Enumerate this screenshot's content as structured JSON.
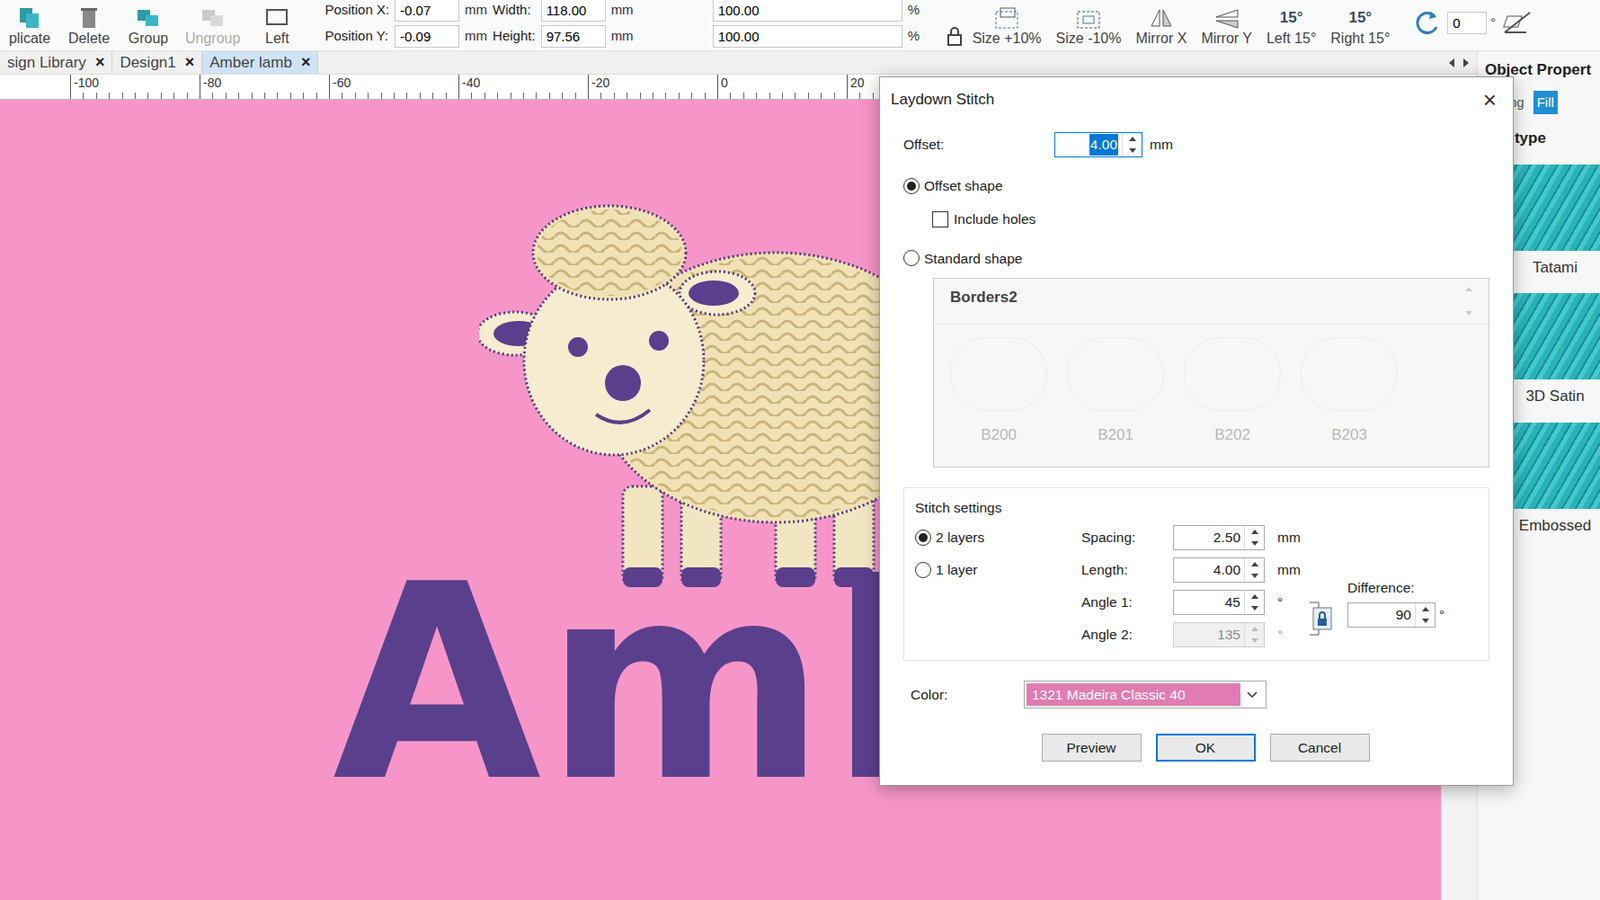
{
  "toolbar": {
    "buttons": [
      {
        "label": "plicate",
        "disabled": false
      },
      {
        "label": "Delete",
        "disabled": false
      },
      {
        "label": "Group",
        "disabled": false
      },
      {
        "label": "Ungroup",
        "disabled": true
      },
      {
        "label": "Left",
        "disabled": false
      }
    ],
    "fields": [
      [
        {
          "label": "Position X:",
          "value": "-0.07",
          "unit": "mm"
        },
        {
          "label": "Width:",
          "value": "118.00",
          "unit": "mm"
        },
        {
          "label": "",
          "value": "100.00",
          "unit": "%"
        }
      ],
      [
        {
          "label": "Position Y:",
          "value": "-0.09",
          "unit": "mm"
        },
        {
          "label": "Height:",
          "value": "97.56",
          "unit": "mm"
        },
        {
          "label": "",
          "value": "100.00",
          "unit": "%"
        }
      ]
    ],
    "transforms": [
      {
        "label": "Size +10%",
        "kind": "grow"
      },
      {
        "label": "Size -10%",
        "kind": "shrink"
      },
      {
        "label": "Mirror X",
        "kind": "mirrorx"
      },
      {
        "label": "Mirror Y",
        "kind": "mirrory"
      },
      {
        "label": "Left 15°",
        "kind": "rotate",
        "badge": "15°"
      },
      {
        "label": "Right 15°",
        "kind": "rotate",
        "badge": "15°"
      }
    ],
    "rotation": {
      "value": "0",
      "unit": "°"
    }
  },
  "doc_tabs": [
    {
      "label": "sign Library",
      "close": "×",
      "selected": false
    },
    {
      "label": "Design1",
      "close": "×",
      "selected": false
    },
    {
      "label": "Amber lamb",
      "close": "×",
      "selected": true
    }
  ],
  "ruler": [
    "-100",
    "-80",
    "-60",
    "-40",
    "-20",
    "0",
    "20"
  ],
  "canvas": {
    "lettering": "Ambe"
  },
  "properties": {
    "title": "Object Propert",
    "tabs": [
      {
        "label": "ttering",
        "selected": false
      },
      {
        "label": "Fill",
        "selected": true
      }
    ],
    "section": "itch type",
    "stitch_types": [
      "Tatami",
      "3D Satin",
      "Embossed"
    ]
  },
  "dialog": {
    "title": "Laydown Stitch",
    "close": "×",
    "offset": {
      "label": "Offset:",
      "value": "4.00",
      "unit": "mm",
      "text_selected": true
    },
    "shape_options": [
      {
        "label": "Offset shape",
        "selected": true
      },
      {
        "label": "Standard shape",
        "selected": false
      }
    ],
    "include_holes": {
      "label": "Include holes",
      "checked": false
    },
    "borders": {
      "title": "Borders2",
      "disabled": true,
      "items": [
        "B200",
        "B201",
        "B202",
        "B203"
      ]
    },
    "stitch_settings": {
      "title": "Stitch settings",
      "layers": [
        {
          "label": "2 layers",
          "selected": true
        },
        {
          "label": "1 layer",
          "selected": false
        }
      ],
      "fields": [
        {
          "label": "Spacing:",
          "value": "2.50",
          "unit": "mm",
          "disabled": false
        },
        {
          "label": "Length:",
          "value": "4.00",
          "unit": "mm",
          "disabled": false
        },
        {
          "label": "Angle 1:",
          "value": "45",
          "unit": "°",
          "disabled": false
        },
        {
          "label": "Angle 2:",
          "value": "135",
          "unit": "°",
          "disabled": true
        }
      ],
      "angles_locked": true,
      "difference": {
        "label": "Difference:",
        "value": "90",
        "unit": "°"
      }
    },
    "color": {
      "label": "Color:",
      "value": "1321 Madeira Classic 40",
      "swatch": "#e07cb1"
    },
    "buttons": [
      {
        "label": "Preview",
        "default": false
      },
      {
        "label": "OK",
        "default": true
      },
      {
        "label": "Cancel",
        "default": false
      }
    ]
  }
}
